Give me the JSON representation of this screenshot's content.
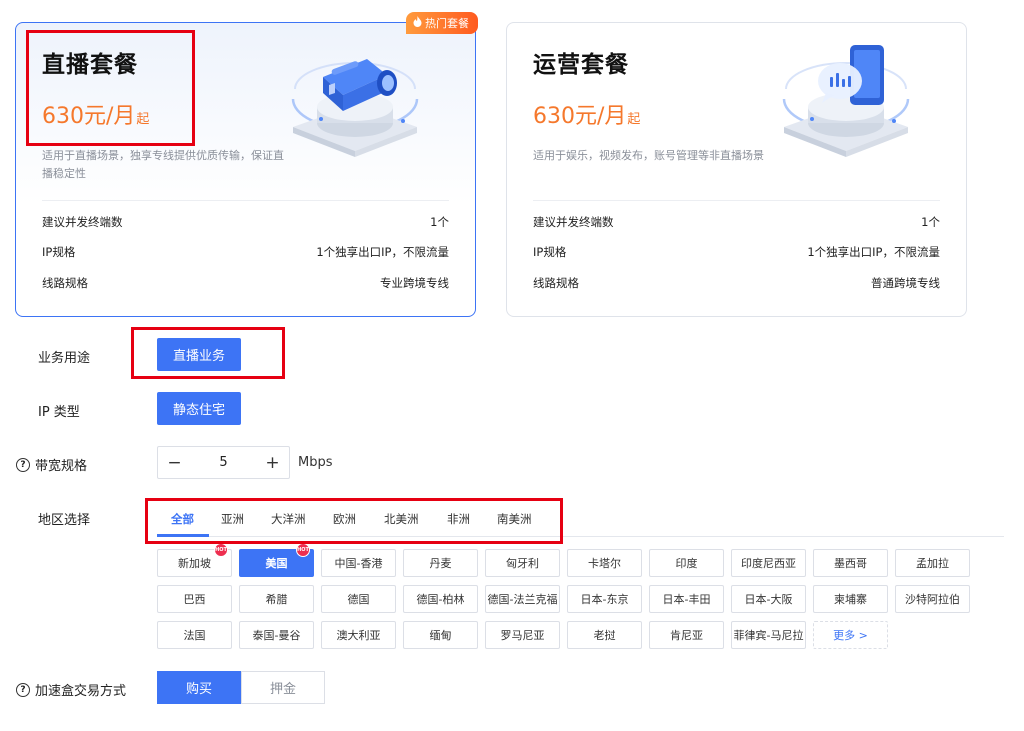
{
  "plans": [
    {
      "title": "直播套餐",
      "price": "630元/月",
      "price_suffix": "起",
      "description": "适用于直播场景，独享专线提供优质传输，保证直播稳定性",
      "hot_tag": "热门套餐",
      "specs": [
        {
          "label": "建议并发终端数",
          "value": "1个"
        },
        {
          "label": "IP规格",
          "value": "1个独享出口IP，不限流量"
        },
        {
          "label": "线路规格",
          "value": "专业跨境专线"
        }
      ],
      "illustration": "camera-icon"
    },
    {
      "title": "运营套餐",
      "price": "630元/月",
      "price_suffix": "起",
      "description": "适用于娱乐，视频发布，账号管理等非直播场景",
      "specs": [
        {
          "label": "建议并发终端数",
          "value": "1个"
        },
        {
          "label": "IP规格",
          "value": "1个独享出口IP，不限流量"
        },
        {
          "label": "线路规格",
          "value": "普通跨境专线"
        }
      ],
      "illustration": "phone-chat-icon"
    }
  ],
  "form": {
    "usage": {
      "label": "业务用途",
      "value": "直播业务"
    },
    "ip_type": {
      "label": "IP 类型",
      "value": "静态住宅"
    },
    "bandwidth": {
      "label": "带宽规格",
      "minus": "−",
      "value": "5",
      "plus": "+",
      "unit": "Mbps"
    },
    "region": {
      "label": "地区选择",
      "tabs": [
        "全部",
        "亚洲",
        "大洋洲",
        "欧洲",
        "北美洲",
        "非洲",
        "南美洲"
      ],
      "active_tab": "全部",
      "chips": [
        "新加坡",
        "美国",
        "中国-香港",
        "丹麦",
        "匈牙利",
        "卡塔尔",
        "印度",
        "印度尼西亚",
        "墨西哥",
        "孟加拉",
        "巴西",
        "希腊",
        "德国",
        "德国-柏林",
        "德国-法兰克福",
        "日本-东京",
        "日本-丰田",
        "日本-大阪",
        "柬埔寨",
        "沙特阿拉伯",
        "法国",
        "泰国-曼谷",
        "澳大利亚",
        "缅甸",
        "罗马尼亚",
        "老挝",
        "肯尼亚",
        "菲律宾-马尼拉",
        "更多 >"
      ],
      "selected_chip": "美国",
      "hot_badge": "HOT"
    },
    "payment": {
      "label": "加速盒交易方式",
      "options": [
        "购买",
        "押金"
      ],
      "selected": "购买"
    }
  },
  "colors": {
    "primary": "#3d74f5",
    "price": "#f5782c",
    "highlight_box": "#e60012",
    "hot_tag": "#ff5a1f"
  }
}
